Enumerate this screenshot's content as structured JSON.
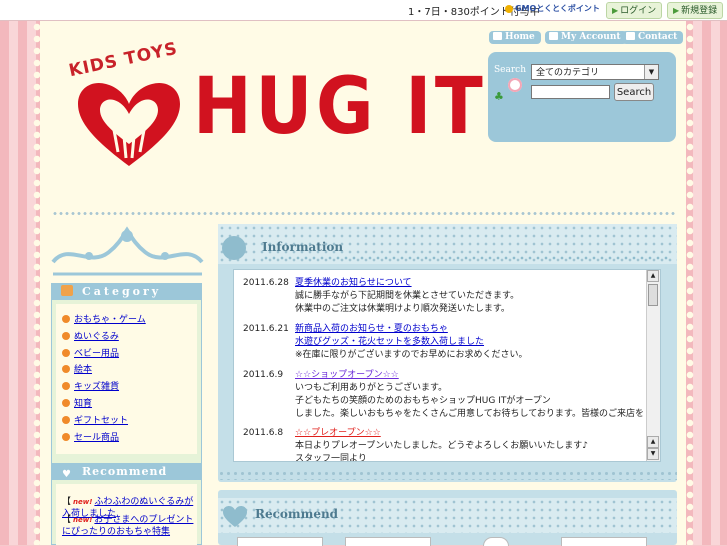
{
  "topbar": {
    "campaign": "1・7日・830ポイント付与中",
    "gmo_points": "GMOとくとくポイント",
    "login": "ログイン",
    "register": "新規登録"
  },
  "logo": {
    "kids_toys": "KIDS TOYS",
    "name": "HUG IT"
  },
  "header_nav": {
    "home": "Home",
    "my_account": "My Account",
    "contact": "Contact"
  },
  "search": {
    "label": "Search",
    "category_selected": "全てのカテゴリ",
    "button": "Search",
    "placeholder": ""
  },
  "sidebar": {
    "category_title": "Category",
    "categories": [
      "おもちゃ・ゲーム",
      "ぬいぐるみ",
      "ベビー用品",
      "絵本",
      "キッズ雑貨",
      "知育",
      "ギフトセット",
      "セール商品"
    ],
    "recommend_title": "Recommend",
    "recommend_items": [
      {
        "badge": "new!",
        "text": "ふわふわのぬいぐるみが入荷しました"
      },
      {
        "badge": "new!",
        "text": "お子さまへのプレゼントにぴったりのおもちゃ特集"
      }
    ]
  },
  "info": {
    "title": "Information",
    "news": [
      {
        "date": "2011.6.28",
        "title": "夏季休業のお知らせについて",
        "lines": [
          "誠に勝手ながら下記期間を休業とさせていただきます。",
          "休業中のご注文は休業明けより順次発送いたします。"
        ]
      },
      {
        "date": "2011.6.21",
        "title": "新商品入荷のお知らせ・夏のおもちゃ",
        "title2": "水遊びグッズ・花火セットを多数入荷しました",
        "lines": [
          "※在庫に限りがございますのでお早めにお求めください。"
        ]
      },
      {
        "date": "2011.6.9",
        "title": "☆☆ショップオープン☆☆",
        "lines": [
          "いつもご利用ありがとうございます。",
          "子どもたちの笑顔のためのおもちゃショップHUG ITがオープン",
          "しました。楽しいおもちゃをたくさんご用意してお待ちしております。皆様のご来店を"
        ]
      },
      {
        "date": "2011.6.8",
        "title": "☆☆プレオープン☆☆",
        "lines": [
          "本日よりプレオープンいたしました。どうぞよろしくお願いいたします♪",
          "スタッフ一同より"
        ]
      }
    ]
  },
  "main_recommend": {
    "title": "Recommend"
  },
  "colors": {
    "accent_blue": "#9cc7d9",
    "brand_red": "#d1121f",
    "background_pink": "#f6c9cc",
    "paper": "#fffbe6"
  }
}
